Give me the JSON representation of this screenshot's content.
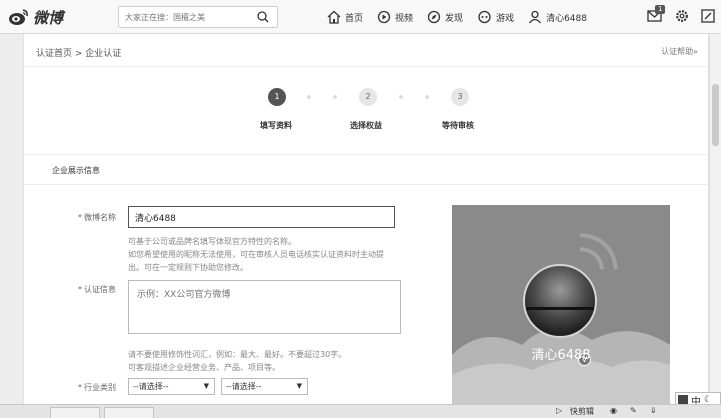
{
  "header": {
    "logo_text": "微博",
    "search_placeholder": "大家正在搜：国檀之美",
    "nav": [
      {
        "label": "首页",
        "icon": "home-icon"
      },
      {
        "label": "视频",
        "icon": "video-icon"
      },
      {
        "label": "发现",
        "icon": "compass-icon"
      },
      {
        "label": "游戏",
        "icon": "gamepad-icon"
      },
      {
        "label": "清心6488",
        "icon": "user-icon"
      }
    ],
    "message_badge": "1"
  },
  "breadcrumb": "认证首页 > 企业认证",
  "help_link": "认证帮助»",
  "steps": [
    {
      "num": "1",
      "label": "填写资料",
      "state": "active"
    },
    {
      "num": "2",
      "label": "选择权益",
      "state": "pending"
    },
    {
      "num": "3",
      "label": "等待审核",
      "state": "pending"
    }
  ],
  "section_title": "企业展示信息",
  "form": {
    "weibo_name": {
      "label": "微博名称",
      "value": "清心6488",
      "hint1": "可基于公司或品牌名填写体现官方特性的名称。",
      "hint2": "如您希望使用的昵称无法使用，可在审核人员电话核实认证资料时主动提",
      "hint3": "出。可在一定规则下协助您修改。"
    },
    "cert_info": {
      "label": "认证信息",
      "placeholder": "示例：XX公司官方微博",
      "hint1": "请不要使用修饰性词汇，例如：最大、最好。不要超过30字。",
      "hint2": "可客观描述企业经营业务、产品、项目等。"
    },
    "industry": {
      "label": "行业类别",
      "select1": "--请选择--",
      "select2": "--请选择--"
    },
    "required_mark": "*"
  },
  "preview": {
    "name": "清心6488",
    "verified_mark": "V"
  },
  "statusbar": {
    "quick_clip": "快剪辑",
    "ime_label": "中"
  }
}
